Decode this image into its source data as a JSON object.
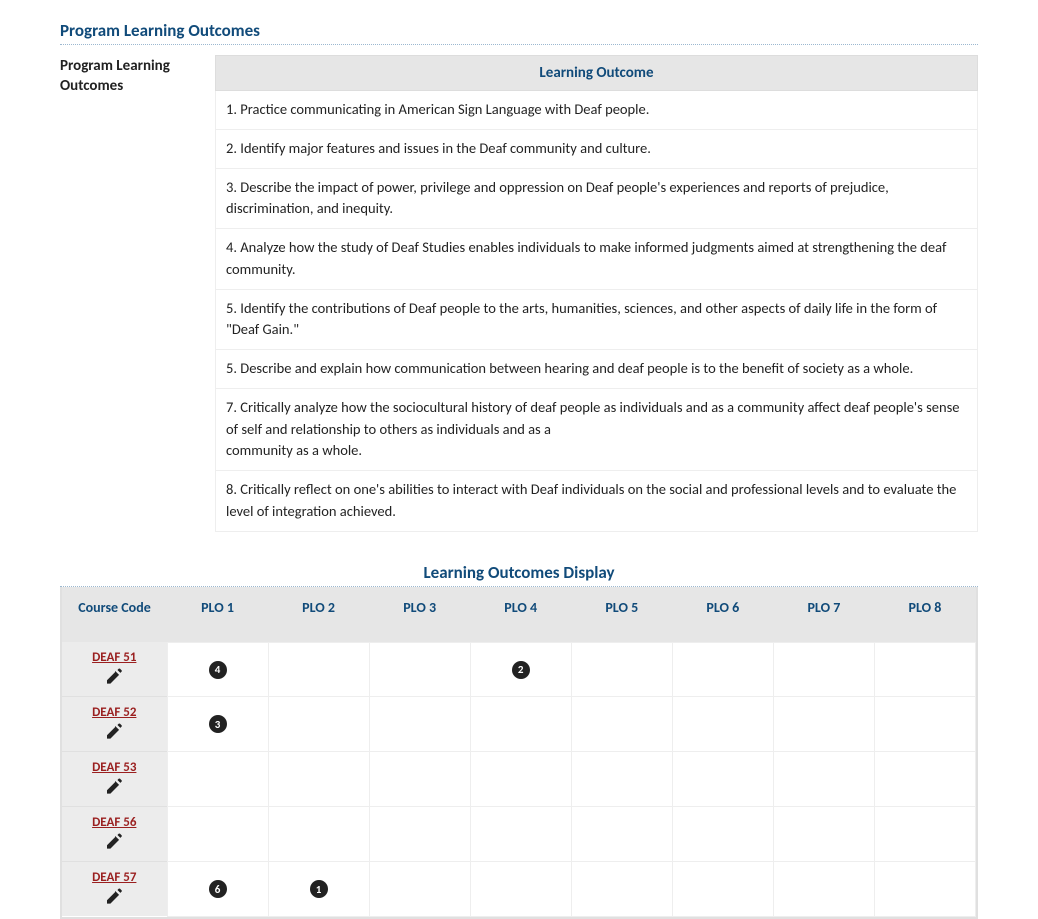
{
  "section1": {
    "heading": "Program Learning Outcomes",
    "side_label": "Program Learning Outcomes",
    "table_header": "Learning Outcome",
    "outcomes": [
      "1. Practice communicating in American Sign Language with Deaf people.",
      "2. Identify major features and issues in the Deaf community and culture.",
      "3. Describe the impact of power, privilege and oppression on Deaf people's experiences and reports of prejudice, discrimination, and inequity.",
      "4. Analyze how the study of Deaf Studies enables individuals to make informed judgments aimed at strengthening the deaf community.",
      "5. Identify the contributions of Deaf people to the arts, humanities, sciences, and other aspects of daily life in the form of \"Deaf Gain.\"",
      "5. Describe and explain how communication between hearing and deaf people is to the benefit of society as a whole.",
      "7. Critically analyze how the sociocultural history of deaf people as individuals and as a community affect deaf people's sense of self and relationship to others as individuals and as a\ncommunity as a whole.",
      "8. Critically reflect on one's abilities to interact with Deaf individuals on the social and professional levels and to evaluate the level of integration achieved."
    ]
  },
  "section2": {
    "heading": "Learning Outcomes Display",
    "columns": [
      "Course Code",
      "PLO 1",
      "PLO 2",
      "PLO 3",
      "PLO 4",
      "PLO 5",
      "PLO 6",
      "PLO 7",
      "PLO 8"
    ],
    "rows": [
      {
        "code": "DEAF 51",
        "cells": [
          "4",
          "",
          "",
          "2",
          "",
          "",
          "",
          ""
        ]
      },
      {
        "code": "DEAF 52",
        "cells": [
          "3",
          "",
          "",
          "",
          "",
          "",
          "",
          ""
        ]
      },
      {
        "code": "DEAF 53",
        "cells": [
          "",
          "",
          "",
          "",
          "",
          "",
          "",
          ""
        ]
      },
      {
        "code": "DEAF 56",
        "cells": [
          "",
          "",
          "",
          "",
          "",
          "",
          "",
          ""
        ]
      },
      {
        "code": "DEAF 57",
        "cells": [
          "6",
          "1",
          "",
          "",
          "",
          "",
          "",
          ""
        ]
      }
    ]
  }
}
